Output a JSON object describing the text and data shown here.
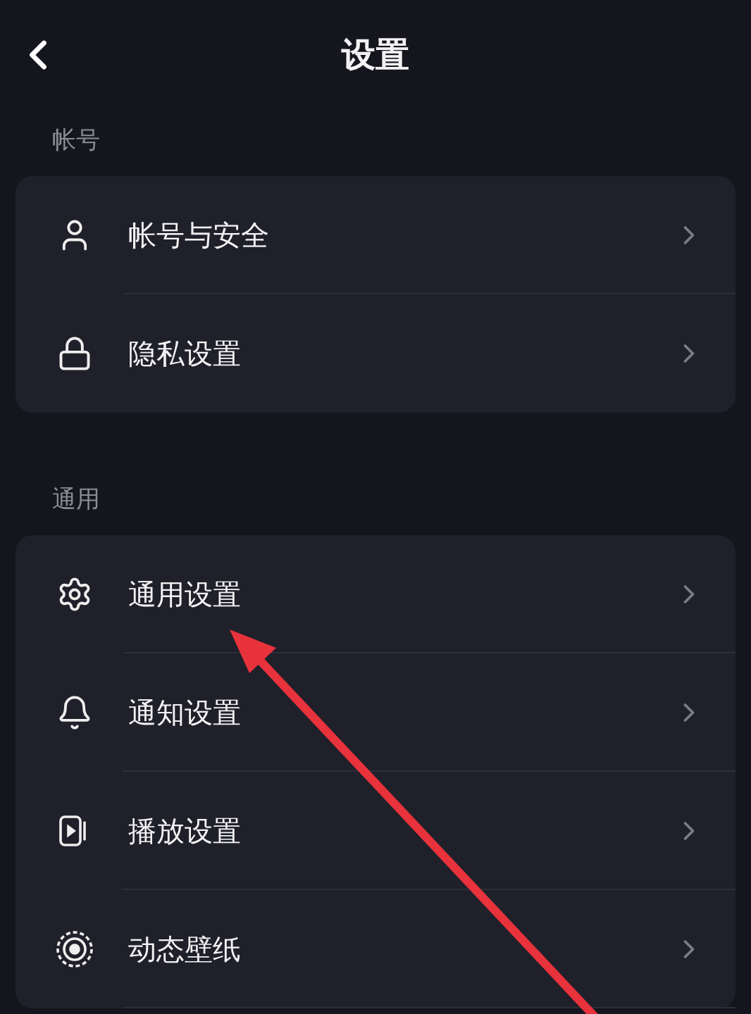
{
  "header": {
    "title": "设置"
  },
  "sections": [
    {
      "label": "帐号",
      "items": [
        {
          "kind": "user",
          "label": "帐号与安全"
        },
        {
          "kind": "lock",
          "label": "隐私设置"
        }
      ]
    },
    {
      "label": "通用",
      "items": [
        {
          "kind": "gear",
          "label": "通用设置"
        },
        {
          "kind": "bell",
          "label": "通知设置"
        },
        {
          "kind": "player",
          "label": "播放设置"
        },
        {
          "kind": "wallpaper",
          "label": "动态壁纸"
        }
      ]
    }
  ]
}
